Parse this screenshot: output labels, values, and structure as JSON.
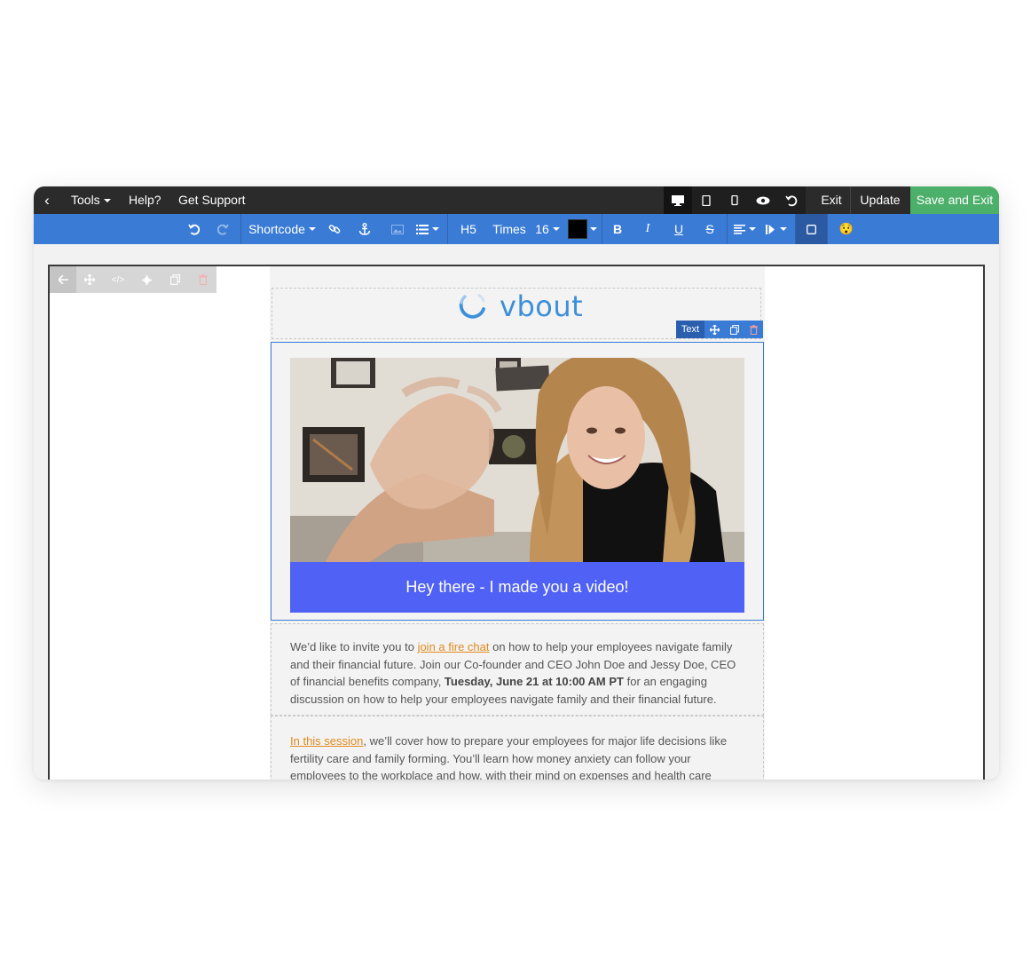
{
  "topbar": {
    "tools_label": "Tools",
    "help_label": "Help?",
    "support_label": "Get Support",
    "exit_label": "Exit",
    "update_label": "Update",
    "save_exit_label": "Save and Exit",
    "device_icons": [
      "desktop-icon",
      "tablet-icon",
      "mobile-icon",
      "preview-eye-icon",
      "history-icon"
    ]
  },
  "toolbar": {
    "shortcode_label": "Shortcode",
    "heading_label": "H5",
    "font_label": "Times",
    "size_label": "16",
    "bold_label": "B",
    "italic_label": "I",
    "underline_label": "U",
    "strike_label": "S",
    "color_value": "#000000",
    "emoji": "😯"
  },
  "element_toolbar": {
    "label": "Text"
  },
  "email": {
    "logo_text": "vbout",
    "video_cta": "Hey there - I made you a video!",
    "p1_prefix": "We’d like to invite you to ",
    "p1_link": "join a fire chat",
    "p1_middle": " on how to help your employees navigate family and their financial future. Join our Co-founder and CEO John Doe and Jessy Doe, CEO of financial benefits company, ",
    "p1_bold": "Tuesday, June 21 at 10:00 AM PT",
    "p1_suffix": " for an engaging discussion on how to help your employees navigate family and their financial future.",
    "p2_link": "In this session",
    "p2_text": ", we’ll cover how to prepare your employees for major life decisions like fertility care and family forming. You’ll learn how money anxiety can follow your employees to the workplace and how, with their mind on expenses and health care"
  },
  "colors": {
    "topbar_bg": "#2b2b2b",
    "toolbar_bg": "#3a7bd5",
    "save_button": "#4caf6a",
    "cta_bg": "#5061f5",
    "link": "#e08a1e",
    "logo": "#3d8fd8"
  }
}
